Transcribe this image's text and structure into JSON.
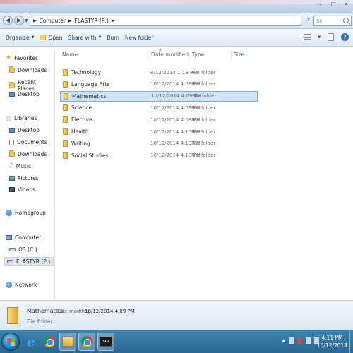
{
  "window": {
    "minimize": "–",
    "maximize": "□",
    "close": "✕"
  },
  "address": {
    "crumbs": [
      "Computer",
      "FLASTYR (P:)"
    ],
    "search_placeholder": "Se"
  },
  "toolbar": {
    "organize": "Organize",
    "open": "Open",
    "share_with": "Share with",
    "burn": "Burn",
    "new_folder": "New folder"
  },
  "nav": {
    "favorites": "Favorites",
    "downloads": "Downloads",
    "recent_places": "Recent Places",
    "desktop": "Desktop",
    "libraries": "Libraries",
    "lib_desktop": "Desktop",
    "documents": "Documents",
    "lib_downloads": "Downloads",
    "music": "Music",
    "pictures": "Pictures",
    "videos": "Videos",
    "homegroup": "Homegroup",
    "computer": "Computer",
    "os_drive": "OS (C:)",
    "flastyr_drive": "FLASTYR (P:)",
    "network": "Network"
  },
  "columns": {
    "name": "Name",
    "date_modified": "Date modified",
    "type": "Type",
    "size": "Size"
  },
  "files": [
    {
      "name": "Technology",
      "date": "8/12/2014 1:18 PM",
      "type": "File folder"
    },
    {
      "name": "Language Arts",
      "date": "10/12/2014 4:08 PM",
      "type": "File folder"
    },
    {
      "name": "Mathematics",
      "date": "10/12/2014 4:09 PM",
      "type": "File folder"
    },
    {
      "name": "Science",
      "date": "10/12/2014 4:09 PM",
      "type": "File folder"
    },
    {
      "name": "Elective",
      "date": "10/12/2014 4:09 PM",
      "type": "File folder"
    },
    {
      "name": "Health",
      "date": "10/12/2014 4:10 PM",
      "type": "File folder"
    },
    {
      "name": "Writing",
      "date": "10/12/2014 4:10 PM",
      "type": "File folder"
    },
    {
      "name": "Social Studies",
      "date": "10/12/2014 4:10 PM",
      "type": "File folder"
    }
  ],
  "selected_index": 2,
  "details": {
    "name": "Mathematics",
    "modified_label": "Date modified:",
    "modified_value": "10/12/2014 4:09 PM",
    "type": "File folder"
  },
  "taskbar": {
    "snagit_label": "SGI",
    "time": "4:11 PM",
    "date": "10/12/2014"
  },
  "colors": {
    "selection": "#cce4f7",
    "taskbar": "#2a6690"
  }
}
